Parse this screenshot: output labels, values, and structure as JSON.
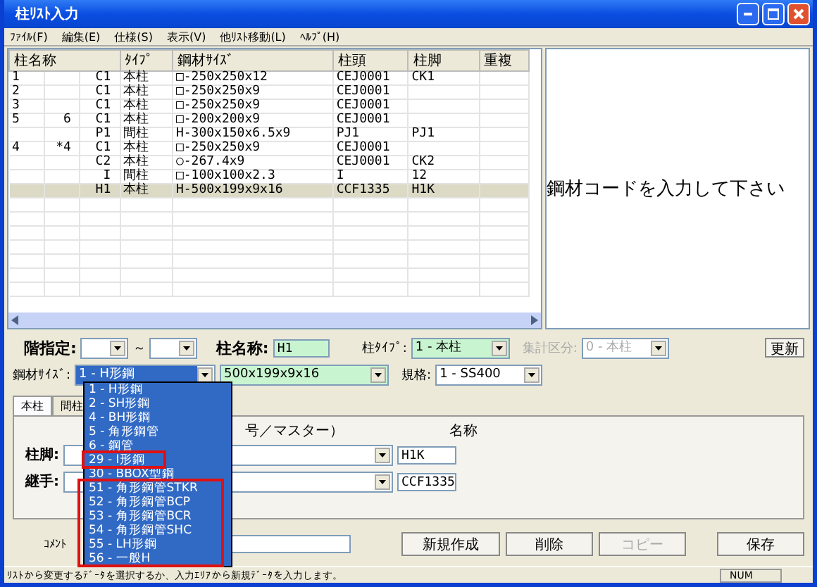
{
  "window": {
    "title": "柱ﾘｽﾄ入力"
  },
  "menu": [
    "ﾌｧｲﾙ(F)",
    "編集(E)",
    "仕様(S)",
    "表示(V)",
    "他ﾘｽﾄ移動(L)",
    "ﾍﾙﾌﾟ(H)"
  ],
  "table": {
    "columns": [
      "柱名称",
      "ﾀｲﾌﾟ",
      "鋼材ｻｲｽﾞ",
      "柱頭",
      "柱脚",
      "重複"
    ],
    "rows": [
      {
        "name_1": "1",
        "name_3": "C1",
        "type": "本柱",
        "size": "□-250x250x12",
        "head": "CEJ0001",
        "foot": "CK1",
        "selected": false
      },
      {
        "name_1": "2",
        "name_3": "C1",
        "type": "本柱",
        "size": "□-250x250x9",
        "head": "CEJ0001",
        "selected": false
      },
      {
        "name_1": "3",
        "name_3": "C1",
        "type": "本柱",
        "size": "□-250x250x9",
        "head": "CEJ0001",
        "selected": false
      },
      {
        "name_1": "5",
        "name_2": "6",
        "name_3": "C1",
        "type": "本柱",
        "size": "□-200x200x9",
        "head": "CEJ0001",
        "selected": false
      },
      {
        "name_3": "P1",
        "type": "間柱",
        "size": "H-300x150x6.5x9",
        "head": "PJ1",
        "foot": "PJ1",
        "selected": false
      },
      {
        "name_1": "4",
        "name_2": "*4",
        "name_3": "C1",
        "type": "本柱",
        "size": "□-250x250x9",
        "head": "CEJ0001",
        "selected": false
      },
      {
        "name_3": "C2",
        "type": "本柱",
        "size": "○-267.4x9",
        "head": "CEJ0001",
        "foot": "CK2",
        "selected": false
      },
      {
        "name_3": "I",
        "type": "間柱",
        "size": "□-100x100x2.3",
        "head": "I",
        "foot": "12",
        "selected": false
      },
      {
        "name_3": "H1",
        "type": "本柱",
        "size": "H-500x199x9x16",
        "head": "CCF1335",
        "foot": "H1K",
        "selected": true
      }
    ]
  },
  "preview_message": "鋼材コードを入力して下さい",
  "filters": {
    "floor_label": "階指定:",
    "range_sep": "～",
    "name_label": "柱名称:",
    "name_value": "H1",
    "type_label": "柱ﾀｲﾌﾟ:",
    "type_value": "1 - 本柱",
    "total_label": "集計区分:",
    "total_value": "0 - 本柱",
    "update_button": "更新",
    "size_label": "鋼材ｻｲｽﾞ:",
    "size_value": "1 - H形鋼",
    "dims_value": "500x199x9x16",
    "spec_label": "規格:",
    "spec_value": "1 - SS400"
  },
  "tabs": [
    {
      "label": "本柱",
      "selected": true
    },
    {
      "label": "間柱",
      "selected": false
    }
  ],
  "joints": {
    "header_fragment": "号／マスター）",
    "name_header": "名称",
    "rows": [
      {
        "label": "柱脚:",
        "value": "H1K"
      },
      {
        "label": "継手:",
        "value": "CCF1335"
      }
    ]
  },
  "comment_label": "ｺﾒﾝﾄ",
  "buttons": [
    {
      "label": "新規作成",
      "disabled": false
    },
    {
      "label": "削除",
      "disabled": false
    },
    {
      "label": "コピー",
      "disabled": true
    },
    {
      "label": "保存",
      "disabled": false
    }
  ],
  "dropdown": [
    {
      "label": "1 - H形鋼",
      "highlighted": false
    },
    {
      "label": "2 - SH形鋼",
      "highlighted": false
    },
    {
      "label": "4 - BH形鋼",
      "highlighted": false
    },
    {
      "label": "5 - 角形鋼管",
      "highlighted": false
    },
    {
      "label": "6 - 鋼管",
      "highlighted": false
    },
    {
      "label": "29 - I形鋼",
      "highlighted": true
    },
    {
      "label": "30 - BBOX型鋼",
      "highlighted": false
    },
    {
      "label": "51 - 角形鋼管STKR",
      "highlighted": true
    },
    {
      "label": "52 - 角形鋼管BCP",
      "highlighted": true
    },
    {
      "label": "53 - 角形鋼管BCR",
      "highlighted": true
    },
    {
      "label": "54 - 角形鋼管SHC",
      "highlighted": true
    },
    {
      "label": "55 - LH形鋼",
      "highlighted": true
    },
    {
      "label": "56 - 一般H",
      "highlighted": true
    }
  ],
  "status_bar": {
    "message": "ﾘｽﾄから変更するﾃﾞｰﾀを選択するか、入力ｴﾘｱから新規ﾃﾞｰﾀを入力します。",
    "indicator": "NUM"
  }
}
